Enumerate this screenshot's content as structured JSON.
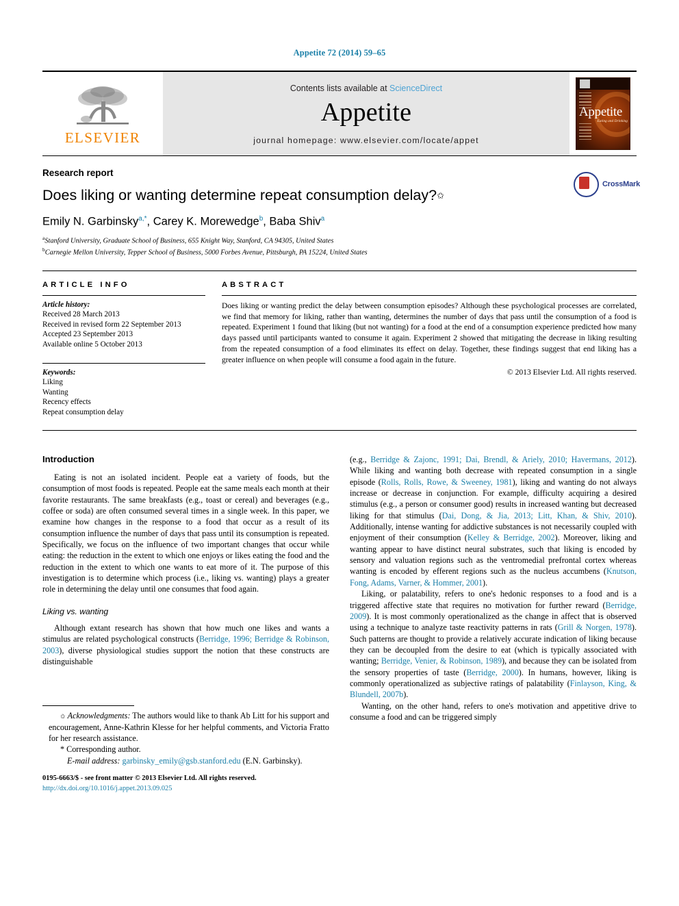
{
  "running_head": "Appetite 72 (2014) 59–65",
  "masthead": {
    "publisher_name": "ELSEVIER",
    "contents_prefix": "Contents lists available at ",
    "contents_link": "ScienceDirect",
    "journal_name": "Appetite",
    "homepage": "journal homepage: www.elsevier.com/locate/appet",
    "cover_title": "Appetite",
    "cover_subtitle": "Eating and Drinking"
  },
  "title_block": {
    "doctype": "Research report",
    "title": "Does liking or wanting determine repeat consumption delay?",
    "title_star": "✩",
    "authors": [
      {
        "name": "Emily N. Garbinsky",
        "marks": "a,*"
      },
      {
        "name": "Carey K. Morewedge",
        "marks": "b"
      },
      {
        "name": "Baba Shiv",
        "marks": "a"
      }
    ],
    "affiliations": [
      {
        "label": "a",
        "text": "Stanford University, Graduate School of Business, 655 Knight Way, Stanford, CA 94305, United States"
      },
      {
        "label": "b",
        "text": "Carnegie Mellon University, Tepper School of Business, 5000 Forbes Avenue, Pittsburgh, PA 15224, United States"
      }
    ],
    "crossmark_label": "CrossMark"
  },
  "article_info": {
    "heading": "ARTICLE INFO",
    "history_label": "Article history:",
    "history": [
      "Received 28 March 2013",
      "Received in revised form 22 September 2013",
      "Accepted 23 September 2013",
      "Available online 5 October 2013"
    ],
    "keywords_label": "Keywords:",
    "keywords": [
      "Liking",
      "Wanting",
      "Recency effects",
      "Repeat consumption delay"
    ]
  },
  "abstract": {
    "heading": "ABSTRACT",
    "text": "Does liking or wanting predict the delay between consumption episodes? Although these psychological processes are correlated, we find that memory for liking, rather than wanting, determines the number of days that pass until the consumption of a food is repeated. Experiment 1 found that liking (but not wanting) for a food at the end of a consumption experience predicted how many days passed until participants wanted to consume it again. Experiment 2 showed that mitigating the decrease in liking resulting from the repeated consumption of a food eliminates its effect on delay. Together, these findings suggest that end liking has a greater influence on when people will consume a food again in the future.",
    "copyright": "© 2013 Elsevier Ltd. All rights reserved."
  },
  "body": {
    "intro_heading": "Introduction",
    "intro_p1": "Eating is not an isolated incident. People eat a variety of foods, but the consumption of most foods is repeated. People eat the same meals each month at their favorite restaurants. The same breakfasts (e.g., toast or cereal) and beverages (e.g., coffee or soda) are often consumed several times in a single week. In this paper, we examine how changes in the response to a food that occur as a result of its consumption influence the number of days that pass until its consumption is repeated. Specifically, we focus on the influence of two important changes that occur while eating: the reduction in the extent to which one enjoys or likes eating the food and the reduction in the extent to which one wants to eat more of it. The purpose of this investigation is to determine which process (i.e., liking vs. wanting) plays a greater role in determining the delay until one consumes that food again.",
    "liking_heading": "Liking vs. wanting",
    "liking_p1_a": "Although extant research has shown that how much one likes and wants a stimulus are related psychological constructs (",
    "liking_p1_cite1": "Berridge, 1996; Berridge & Robinson, 2003",
    "liking_p1_b": "), diverse physiological studies support the notion that these constructs are distinguishable",
    "right_p1_a": "(e.g., ",
    "right_p1_cite1": "Berridge & Zajonc, 1991; Dai, Brendl, & Ariely, 2010; Havermans, 2012",
    "right_p1_b": "). While liking and wanting both decrease with repeated consumption in a single episode (",
    "right_p1_cite2": "Rolls, Rolls, Rowe, & Sweeney, 1981",
    "right_p1_c": "), liking and wanting do not always increase or decrease in conjunction. For example, difficulty acquiring a desired stimulus (e.g., a person or consumer good) results in increased wanting but decreased liking for that stimulus (",
    "right_p1_cite3": "Dai, Dong, & Jia, 2013; Litt, Khan, & Shiv, 2010",
    "right_p1_d": "). Additionally, intense wanting for addictive substances is not necessarily coupled with enjoyment of their consumption (",
    "right_p1_cite4": "Kelley & Berridge, 2002",
    "right_p1_e": "). Moreover, liking and wanting appear to have distinct neural substrates, such that liking is encoded by sensory and valuation regions such as the ventromedial prefrontal cortex whereas wanting is encoded by efferent regions such as the nucleus accumbens (",
    "right_p1_cite5": "Knutson, Fong, Adams, Varner, & Hommer, 2001",
    "right_p1_f": ").",
    "right_p2_a": "Liking, or palatability, refers to one's hedonic responses to a food and is a triggered affective state that requires no motivation for further reward (",
    "right_p2_cite1": "Berridge, 2009",
    "right_p2_b": "). It is most commonly operationalized as the change in affect that is observed using a technique to analyze taste reactivity patterns in rats (",
    "right_p2_cite2": "Grill & Norgen, 1978",
    "right_p2_c": "). Such patterns are thought to provide a relatively accurate indication of liking because they can be decoupled from the desire to eat (which is typically associated with wanting; ",
    "right_p2_cite3": "Berridge, Venier, & Robinson, 1989",
    "right_p2_d": "), and because they can be isolated from the sensory properties of taste (",
    "right_p2_cite4": "Berridge, 2000",
    "right_p2_e": "). In humans, however, liking is commonly operationalized as subjective ratings of palatability (",
    "right_p2_cite5": "Finlayson, King, & Blundell, 2007b",
    "right_p2_f": ").",
    "right_p3": "Wanting, on the other hand, refers to one's motivation and appetitive drive to consume a food and can be triggered simply"
  },
  "footnotes": {
    "star": "✩",
    "ack_label": "Acknowledgments:",
    "ack_text": " The authors would like to thank Ab Litt for his support and encouragement, Anne-Kathrin Klesse for her helpful comments, and Victoria Fratto for her research assistance.",
    "corresponding_star": "*",
    "corresponding": "Corresponding author.",
    "email_label": "E-mail address:",
    "email": "garbinsky_emily@gsb.stanford.edu",
    "email_suffix": " (E.N. Garbinsky).",
    "issn_line": "0195-6663/$ - see front matter © 2013 Elsevier Ltd. All rights reserved.",
    "doi": "http://dx.doi.org/10.1016/j.appet.2013.09.025"
  },
  "colors": {
    "link": "#1a7fa8",
    "elsevier_orange": "#ef8200",
    "crossmark_blue": "#2b3f8c",
    "crossmark_red": "#c8322b",
    "masthead_bg": "#e6e6e6"
  }
}
